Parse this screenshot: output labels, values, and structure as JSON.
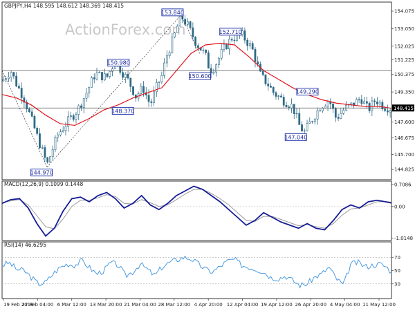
{
  "header": {
    "symbol_line": "GBPJPY,H4 148.595 148.612 148.369 148.415",
    "watermark": "ActionForex.com"
  },
  "colors": {
    "candles": "#2f6a86",
    "ma": "#e0141c",
    "macd_main": "#141c96",
    "macd_signal": "#9a9a9a",
    "rsi": "#4a9ae0",
    "annotation": "#2a3cae",
    "level_line": "#555555",
    "tag_bg": "#000000"
  },
  "chart_data": [
    {
      "type": "candlestick",
      "title": "GBPJPY,H4 148.595 148.612 148.369 148.415",
      "x_tick_labels": [
        "19 Feb 2018",
        "27 Feb 04:00",
        "6 Mar 12:00",
        "13 Mar 20:00",
        "21 Mar 04:00",
        "28 Mar 12:00",
        "4 Apr 20:00",
        "12 Apr 04:00",
        "19 Apr 12:00",
        "26 Apr 20:00",
        "4 May 04:00",
        "11 May 12:00"
      ],
      "y_tick_labels": [
        "154.075",
        "153.050",
        "152.025",
        "151.225",
        "150.375",
        "149.350",
        "148.415",
        "147.600",
        "146.675",
        "145.700",
        "144.825"
      ],
      "ylim": [
        144.35,
        154.4
      ],
      "close_path_x": [
        0,
        6,
        10,
        15,
        20,
        26,
        31,
        38,
        45,
        52,
        58,
        64,
        72,
        78,
        82,
        87,
        92,
        97,
        102,
        107,
        110,
        113,
        118,
        123,
        128,
        133,
        140,
        143,
        146,
        152,
        158,
        165,
        172,
        178,
        183,
        187,
        193,
        200,
        205,
        208,
        213,
        219,
        225,
        230,
        236,
        241,
        247,
        252,
        257,
        263,
        268
      ],
      "close_path_y": [
        150.0,
        150.6,
        149.8,
        149.0,
        147.8,
        146.3,
        145.1,
        146.8,
        147.6,
        148.3,
        149.3,
        150.4,
        150.2,
        151.2,
        150.6,
        150.0,
        149.1,
        149.6,
        148.6,
        149.8,
        150.3,
        151.4,
        152.5,
        153.8,
        153.2,
        152.3,
        151.5,
        150.6,
        150.8,
        151.8,
        152.5,
        152.7,
        151.9,
        150.3,
        149.8,
        149.3,
        148.9,
        148.5,
        147.3,
        147.0,
        147.7,
        148.5,
        148.9,
        147.8,
        148.4,
        148.6,
        149.0,
        148.3,
        148.9,
        148.5,
        148.4
      ],
      "ma_x": [
        0,
        10,
        20,
        30,
        40,
        50,
        60,
        70,
        80,
        90,
        100,
        110,
        120,
        130,
        140,
        150,
        160,
        170,
        180,
        190,
        200,
        210,
        220,
        230,
        240,
        250,
        260,
        268
      ],
      "ma_y": [
        149.2,
        149.0,
        148.6,
        148.0,
        147.5,
        147.4,
        147.8,
        148.3,
        148.6,
        149.0,
        149.3,
        149.6,
        150.6,
        151.6,
        152.1,
        152.2,
        152.1,
        151.4,
        150.6,
        150.1,
        149.6,
        149.2,
        148.9,
        148.7,
        148.6,
        148.5,
        148.5,
        148.4
      ],
      "annotations": [
        {
          "label": "144.970",
          "x": 31,
          "y": 144.97
        },
        {
          "label": "150.980",
          "x": 82,
          "y": 150.98
        },
        {
          "label": "148.370",
          "x": 87,
          "y": 148.37
        },
        {
          "label": "153.840",
          "x": 123,
          "y": 153.84
        },
        {
          "label": "152.710",
          "x": 161,
          "y": 152.71
        },
        {
          "label": "150.600",
          "x": 140,
          "y": 150.6
        },
        {
          "label": "149.290",
          "x": 213,
          "y": 149.29
        },
        {
          "label": "147.040",
          "x": 206,
          "y": 147.04
        }
      ],
      "level_lines": [
        150.6,
        148.415
      ],
      "price_tags": [
        "150.600",
        "148.415"
      ]
    },
    {
      "type": "line",
      "title": "MACD(12,26,9) 0.1099 0.1448",
      "y_tick_labels": [
        "0.7086",
        "0.00",
        "-1.0148"
      ],
      "ylim": [
        -1.05,
        0.75
      ],
      "series": [
        {
          "name": "MACD main",
          "x": [
            0,
            6,
            12,
            18,
            24,
            30,
            36,
            42,
            48,
            54,
            60,
            66,
            72,
            78,
            84,
            90,
            96,
            102,
            108,
            114,
            120,
            126,
            132,
            138,
            144,
            150,
            156,
            162,
            168,
            174,
            180,
            186,
            192,
            198,
            204,
            210,
            216,
            222,
            228,
            234,
            240,
            246,
            252,
            258,
            264,
            268
          ],
          "values": [
            0.1,
            0.22,
            0.25,
            -0.05,
            -0.55,
            -0.95,
            -0.7,
            -0.15,
            0.25,
            0.3,
            0.15,
            0.35,
            0.45,
            0.25,
            -0.05,
            0.1,
            0.35,
            0.05,
            -0.1,
            0.1,
            0.35,
            0.5,
            0.65,
            0.55,
            0.35,
            0.15,
            -0.1,
            -0.35,
            -0.6,
            -0.45,
            -0.2,
            -0.35,
            -0.5,
            -0.6,
            -0.7,
            -0.55,
            -0.7,
            -0.75,
            -0.45,
            -0.1,
            0.05,
            -0.05,
            0.15,
            0.2,
            0.15,
            0.11
          ]
        },
        {
          "name": "Signal",
          "x": [
            0,
            6,
            12,
            18,
            24,
            30,
            36,
            42,
            48,
            54,
            60,
            66,
            72,
            78,
            84,
            90,
            96,
            102,
            108,
            114,
            120,
            126,
            132,
            138,
            144,
            150,
            156,
            162,
            168,
            174,
            180,
            186,
            192,
            198,
            204,
            210,
            216,
            222,
            228,
            234,
            240,
            246,
            252,
            258,
            264,
            268
          ],
          "values": [
            0.12,
            0.18,
            0.22,
            0.05,
            -0.3,
            -0.65,
            -0.72,
            -0.4,
            0.0,
            0.2,
            0.2,
            0.28,
            0.38,
            0.32,
            0.1,
            0.08,
            0.22,
            0.12,
            0.0,
            0.05,
            0.22,
            0.4,
            0.55,
            0.55,
            0.42,
            0.25,
            0.05,
            -0.2,
            -0.45,
            -0.48,
            -0.32,
            -0.32,
            -0.42,
            -0.52,
            -0.62,
            -0.58,
            -0.65,
            -0.7,
            -0.55,
            -0.28,
            -0.08,
            -0.05,
            0.05,
            0.15,
            0.16,
            0.14
          ]
        }
      ]
    },
    {
      "type": "line",
      "title": "RSI(14) 46.6295",
      "y_tick_labels": [
        "70",
        "50",
        "30"
      ],
      "ylim": [
        10,
        90
      ],
      "guides": [
        70,
        30
      ],
      "series": [
        {
          "name": "RSI",
          "x": [
            0,
            5,
            10,
            15,
            20,
            25,
            30,
            35,
            40,
            45,
            50,
            55,
            60,
            65,
            70,
            75,
            80,
            85,
            90,
            95,
            100,
            105,
            110,
            115,
            120,
            125,
            130,
            135,
            140,
            145,
            150,
            155,
            160,
            165,
            170,
            175,
            180,
            185,
            190,
            195,
            200,
            205,
            210,
            215,
            220,
            225,
            230,
            235,
            240,
            245,
            250,
            255,
            260,
            265,
            268
          ],
          "values": [
            58,
            62,
            52,
            50,
            40,
            30,
            32,
            45,
            55,
            60,
            58,
            65,
            55,
            45,
            50,
            62,
            58,
            42,
            48,
            60,
            52,
            42,
            55,
            62,
            66,
            70,
            68,
            60,
            52,
            48,
            56,
            64,
            67,
            58,
            55,
            52,
            48,
            40,
            38,
            42,
            35,
            28,
            30,
            40,
            45,
            55,
            38,
            28,
            60,
            62,
            56,
            58,
            60,
            55,
            46.6
          ]
        }
      ]
    }
  ]
}
